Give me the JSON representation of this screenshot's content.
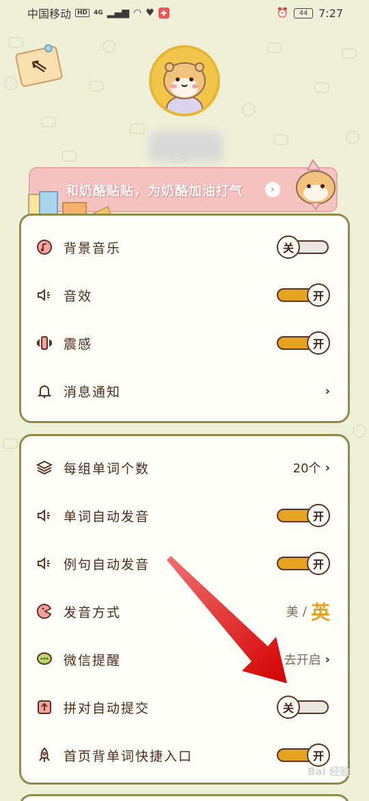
{
  "status_bar": {
    "carrier": "中国移动",
    "hd_badge": "HD",
    "network": "4G",
    "battery": "44",
    "time": "7:27"
  },
  "back_button": {
    "icon": "back-arrow-icon"
  },
  "promo": {
    "text": "和奶酪贴贴，为奶酪加油打气",
    "arrow": "›"
  },
  "sound_settings": {
    "items": [
      {
        "label": "背景音乐",
        "icon": "music-note-icon",
        "toggle": "关",
        "state": "off"
      },
      {
        "label": "音效",
        "icon": "speaker-icon",
        "toggle": "开",
        "state": "on"
      },
      {
        "label": "震感",
        "icon": "vibration-icon",
        "toggle": "开",
        "state": "on"
      },
      {
        "label": "消息通知",
        "icon": "bell-icon",
        "chevron": "›"
      }
    ]
  },
  "word_settings": {
    "group_count": {
      "label": "每组单词个数",
      "value": "20个",
      "chevron": "›"
    },
    "word_auto": {
      "label": "单词自动发音",
      "toggle": "开"
    },
    "sentence_auto": {
      "label": "例句自动发音",
      "toggle": "开"
    },
    "pronunciation": {
      "label": "发音方式",
      "us": "美",
      "sep": "/",
      "uk": "英"
    },
    "wechat": {
      "label": "微信提醒",
      "value": "去开启",
      "chevron": "›"
    },
    "spelling_submit": {
      "label": "拼对自动提交",
      "toggle": "关"
    },
    "home_shortcut": {
      "label": "首页背单词快捷入口",
      "toggle": "开"
    }
  },
  "colors": {
    "accent": "#e6a320",
    "background": "#eef0d8",
    "card_border": "#8f8a4a",
    "text": "#4e2b1d"
  },
  "watermark": "Bai 经验"
}
